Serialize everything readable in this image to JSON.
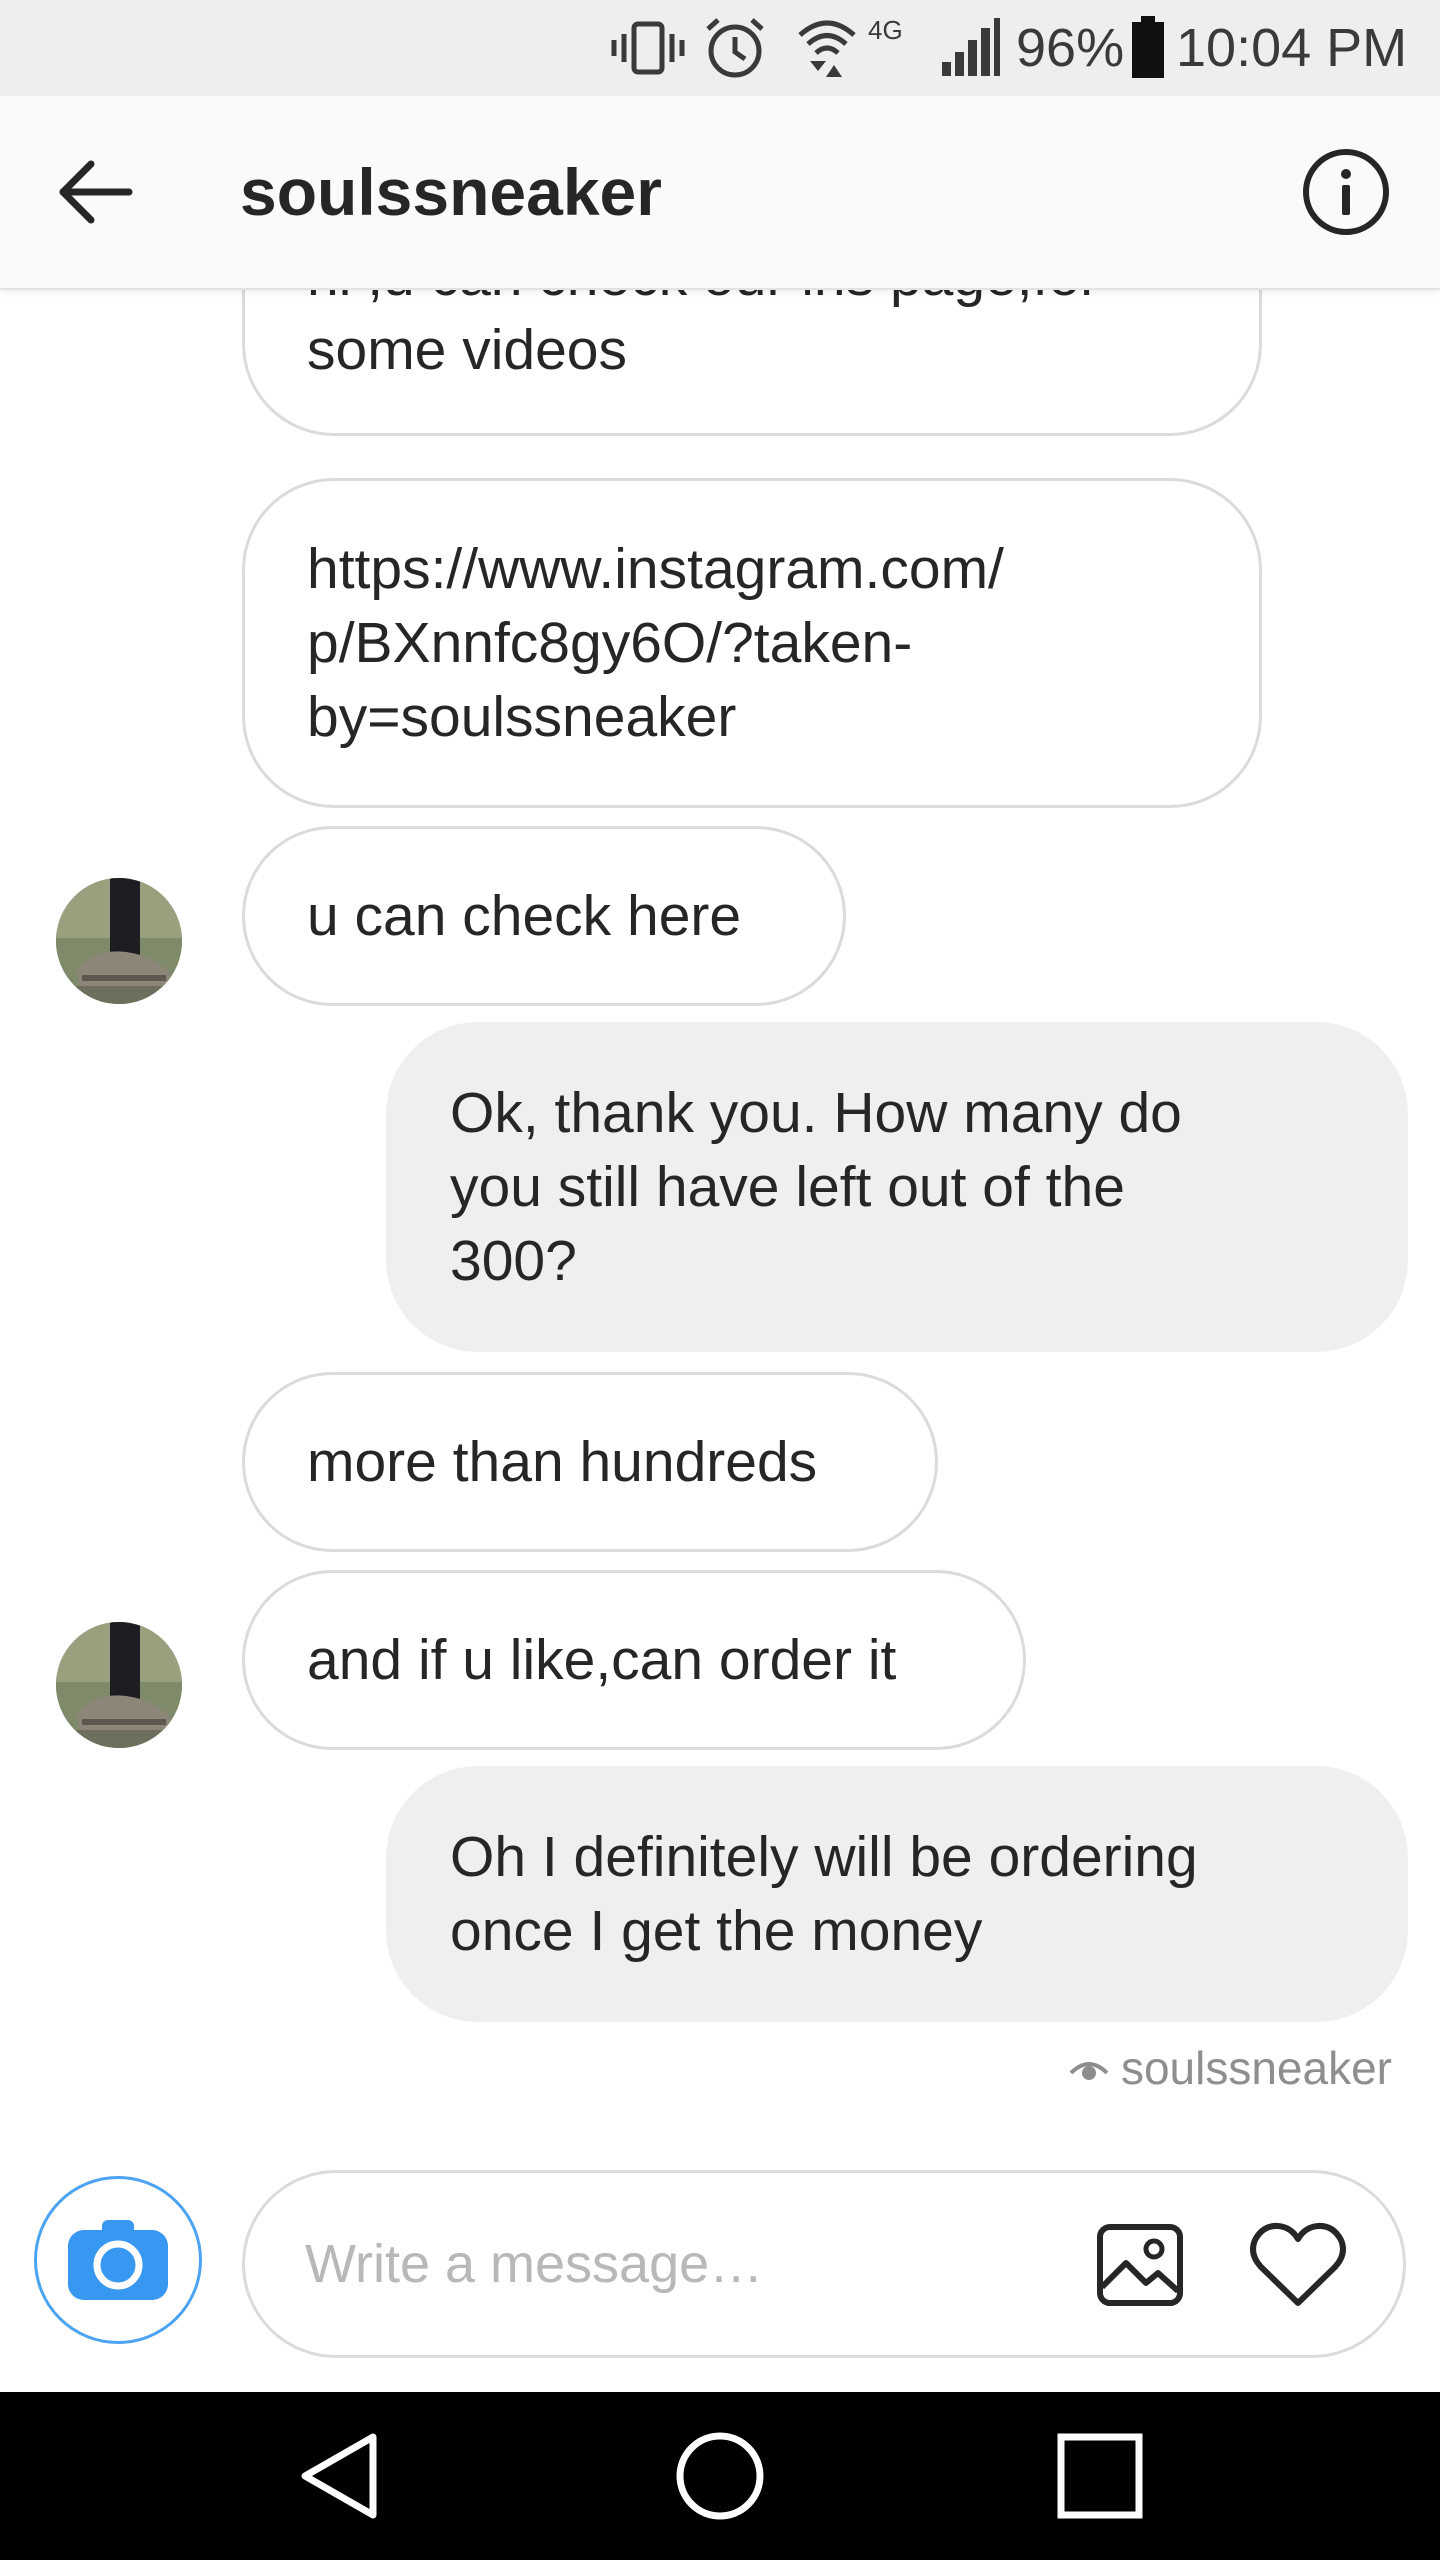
{
  "status_bar": {
    "battery": "96%",
    "time": "10:04 PM",
    "network": "4G",
    "icons": [
      "vibrate-icon",
      "alarm-icon",
      "wifi-icon",
      "signal-icon",
      "battery-icon"
    ]
  },
  "header": {
    "title": "soulssneaker",
    "back_icon": "arrow-left-icon",
    "info_icon": "info-icon"
  },
  "messages": [
    {
      "from": "them",
      "text": "hi ,u can check our ins page,for\nsome videos"
    },
    {
      "from": "them",
      "text": "https://www.instagram.com/\np/BXnnfc8gy6O/?taken-\nby=soulssneaker"
    },
    {
      "from": "them",
      "text": "u can check here"
    },
    {
      "from": "me",
      "text": "Ok, thank you. How many do\nyou still have left out of the\n300?"
    },
    {
      "from": "them",
      "text": "more than hundreds"
    },
    {
      "from": "them",
      "text": "and if u like,can order it"
    },
    {
      "from": "me",
      "text": "Oh I definitely will be ordering\nonce I get the money"
    }
  ],
  "seen_by": "soulssneaker",
  "composer": {
    "placeholder": "Write a message…",
    "value": "",
    "camera_icon": "camera-icon",
    "gallery_icon": "image-icon",
    "like_icon": "heart-icon"
  },
  "nav_bar": {
    "icons": [
      "back-triangle-icon",
      "home-circle-icon",
      "recents-square-icon"
    ]
  },
  "colors": {
    "accent": "#3897f0",
    "incoming_border": "#dbdbdb",
    "outgoing_bg": "#efefef",
    "text": "#262626",
    "muted": "#8e8e8e"
  }
}
